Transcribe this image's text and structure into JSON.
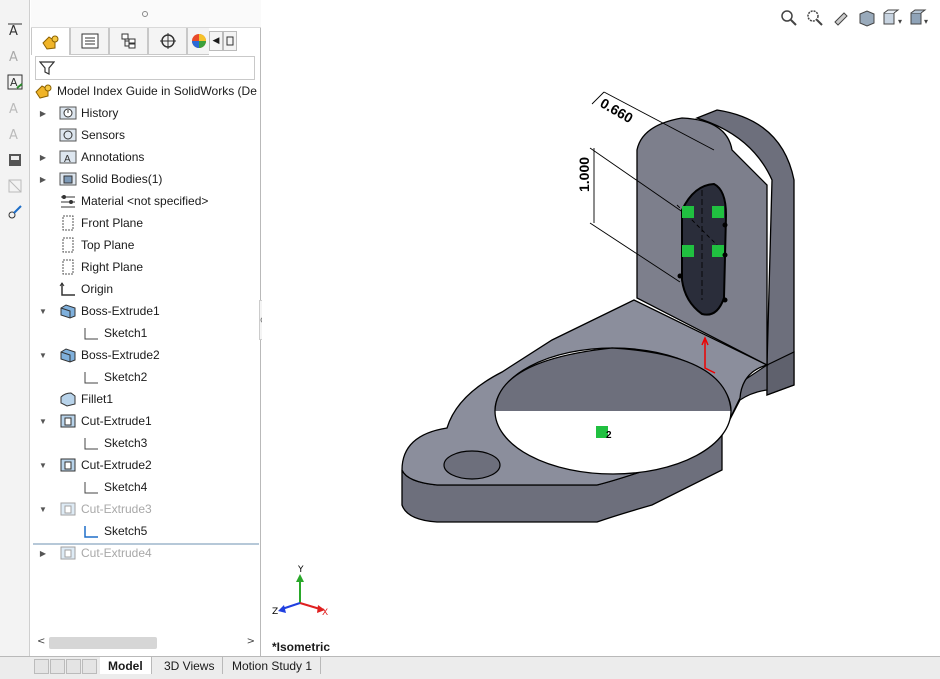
{
  "featuremanager": {
    "tabs": [
      "feature-tree-icon",
      "property-manager-icon",
      "configuration-manager-icon",
      "dimxpert-icon",
      "display-manager-icon"
    ],
    "root_label": "Model Index Guide in SolidWorks  (De",
    "items": [
      {
        "label": "History"
      },
      {
        "label": "Sensors"
      },
      {
        "label": "Annotations"
      },
      {
        "label": "Solid Bodies(1)"
      },
      {
        "label": "Material <not specified>"
      },
      {
        "label": "Front Plane"
      },
      {
        "label": "Top Plane"
      },
      {
        "label": "Right Plane"
      },
      {
        "label": "Origin"
      },
      {
        "label": "Boss-Extrude1"
      },
      {
        "label": "Sketch1"
      },
      {
        "label": "Boss-Extrude2"
      },
      {
        "label": "Sketch2"
      },
      {
        "label": "Fillet1"
      },
      {
        "label": "Cut-Extrude1"
      },
      {
        "label": "Sketch3"
      },
      {
        "label": "Cut-Extrude2"
      },
      {
        "label": "Sketch4"
      },
      {
        "label": "Cut-Extrude3"
      },
      {
        "label": "Sketch5"
      },
      {
        "label": "Cut-Extrude4"
      }
    ]
  },
  "bottom_tabs": [
    "Model",
    "3D Views",
    "Motion Study 1"
  ],
  "viewport": {
    "view_name": "*Isometric",
    "dimensions": [
      "0.660",
      "1.000"
    ],
    "relation_label": "2",
    "triad": {
      "x": "X",
      "y": "Y",
      "z": "Z"
    }
  },
  "colors": {
    "accent": "#1e6ec8",
    "part_face": "#8b8e9c",
    "part_side": "#6d6f7c",
    "relation": "#20c040"
  }
}
